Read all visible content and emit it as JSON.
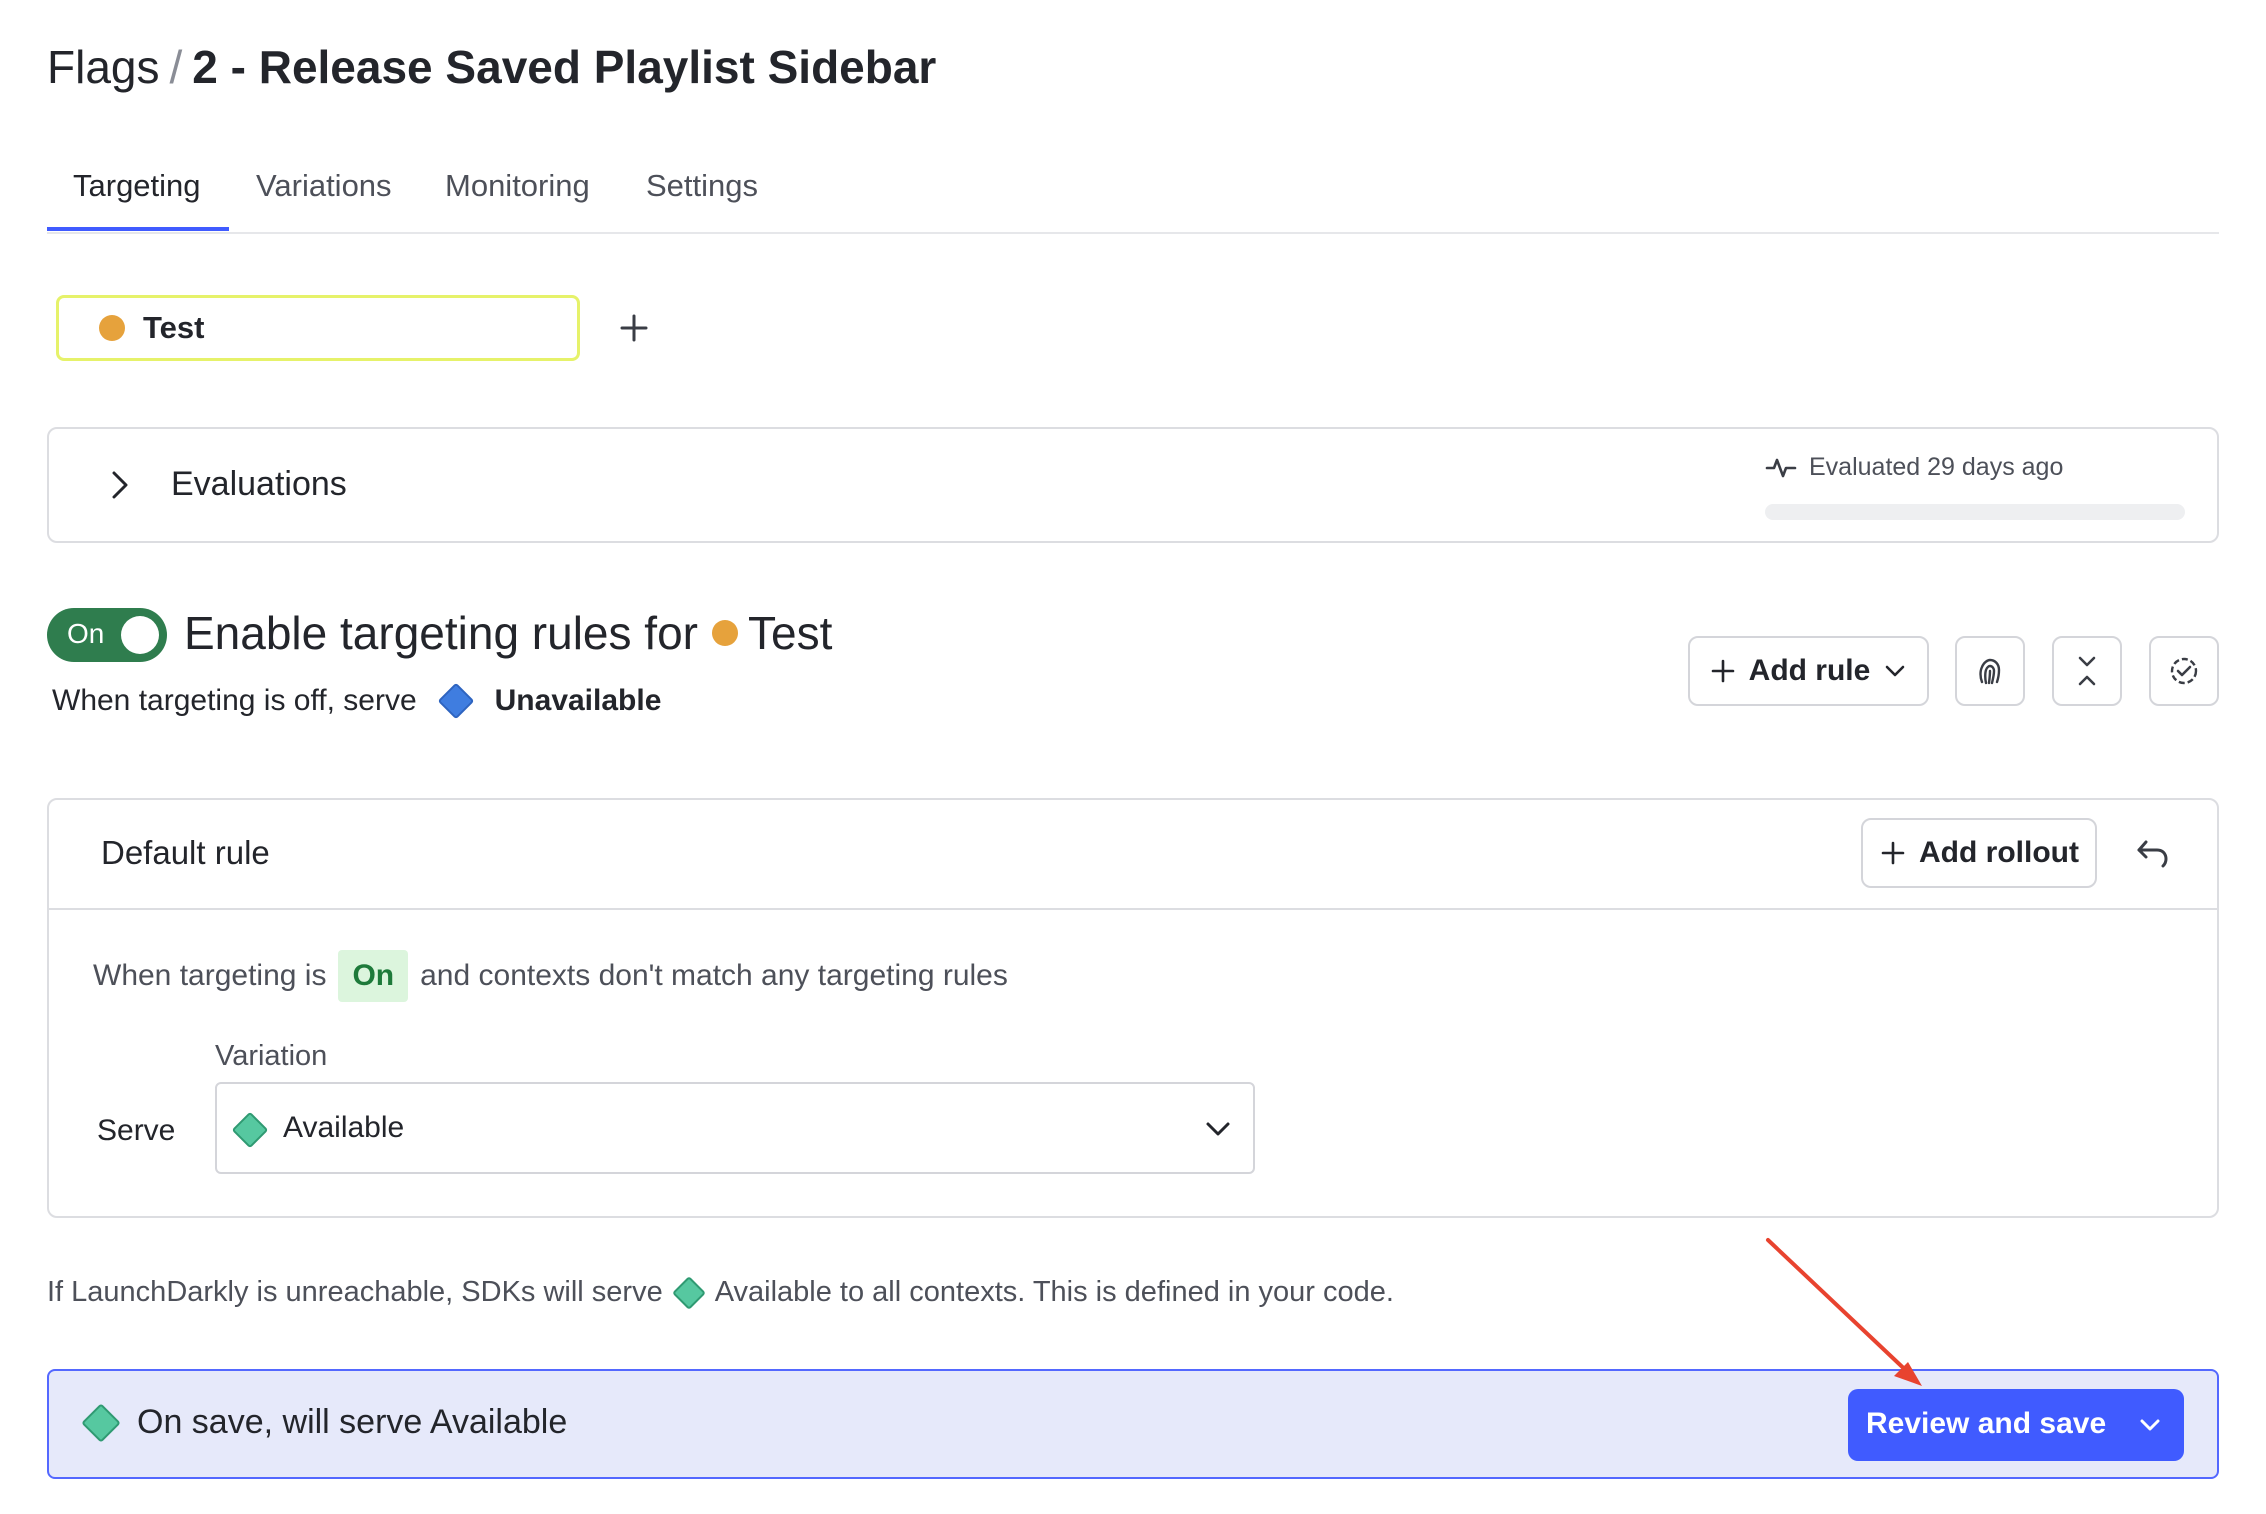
{
  "breadcrumb": {
    "parent": "Flags",
    "separator": "/",
    "current": "2 - Release Saved Playlist Sidebar"
  },
  "tabs": [
    {
      "label": "Targeting",
      "active": true
    },
    {
      "label": "Variations"
    },
    {
      "label": "Monitoring"
    },
    {
      "label": "Settings"
    }
  ],
  "environment": {
    "name": "Test",
    "color": "#e6a23c",
    "add_icon": "plus-icon"
  },
  "evaluations": {
    "title": "Evaluations",
    "status": "Evaluated 29 days ago",
    "icon": "activity-icon"
  },
  "targeting": {
    "toggle_label": "On",
    "toggle_on": true,
    "heading_prefix": "Enable targeting rules for",
    "env_name": "Test",
    "off_text": "When targeting is off, serve",
    "off_variation": "Unavailable",
    "add_rule_label": "Add rule",
    "icons": [
      "fingerprint-icon",
      "collapse-icon",
      "check-badge-icon"
    ]
  },
  "default_rule": {
    "title": "Default rule",
    "add_rollout_label": "Add rollout",
    "desc_before": "When targeting is",
    "desc_pill": "On",
    "desc_after": "and contexts don't match any targeting rules",
    "variation_label": "Variation",
    "serve_label": "Serve",
    "selected_variation": "Available"
  },
  "fallback": {
    "before": "If LaunchDarkly is unreachable, SDKs will serve",
    "after": "Available to all contexts. This is defined in your code."
  },
  "save_bar": {
    "text": "On save, will serve Available",
    "button_label": "Review and save"
  },
  "colors": {
    "accent": "#405bff",
    "toggle_on": "#2f7d4e",
    "available": "#56c8a0",
    "unavailable": "#3f7de0",
    "env_dot": "#e6a23c",
    "annotation_arrow": "#e8432f"
  }
}
